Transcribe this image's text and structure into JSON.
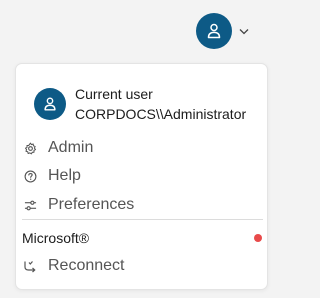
{
  "account_menu": {
    "current_user_label": "Current user",
    "username": "CORPDOCS\\\\Administrator",
    "items": [
      {
        "label": "Admin",
        "icon": "gear-icon"
      },
      {
        "label": "Help",
        "icon": "help-circle-icon"
      },
      {
        "label": "Preferences",
        "icon": "sliders-icon"
      }
    ],
    "provider": {
      "label": "Microsoft®",
      "status_color": "#e84a4a",
      "reconnect_label": "Reconnect",
      "reconnect_icon": "reconnect-icon"
    }
  },
  "colors": {
    "avatar_bg": "#0d5a86",
    "menu_bg": "#ffffff",
    "page_bg": "#f3f3f3"
  }
}
